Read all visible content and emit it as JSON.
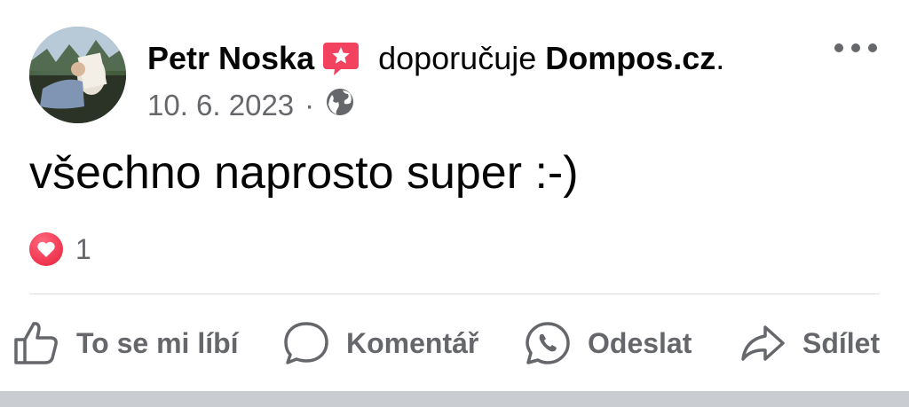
{
  "post": {
    "author": "Petr Noska",
    "action": "doporučuje",
    "page": "Dompos.cz",
    "period": ".",
    "date": "10. 6. 2023",
    "separator": "·",
    "text": "všechno naprosto super :-)"
  },
  "reactions": {
    "count": "1",
    "type": "heart-icon",
    "color": "#f33e58"
  },
  "actions": {
    "like": "To se mi líbí",
    "comment": "Komentář",
    "send": "Odeslat",
    "share": "Sdílet"
  },
  "colors": {
    "secondary_text": "#65676b",
    "primary_text": "#050505",
    "recommend_badge": "#f3425f",
    "divider": "#dadde1"
  }
}
